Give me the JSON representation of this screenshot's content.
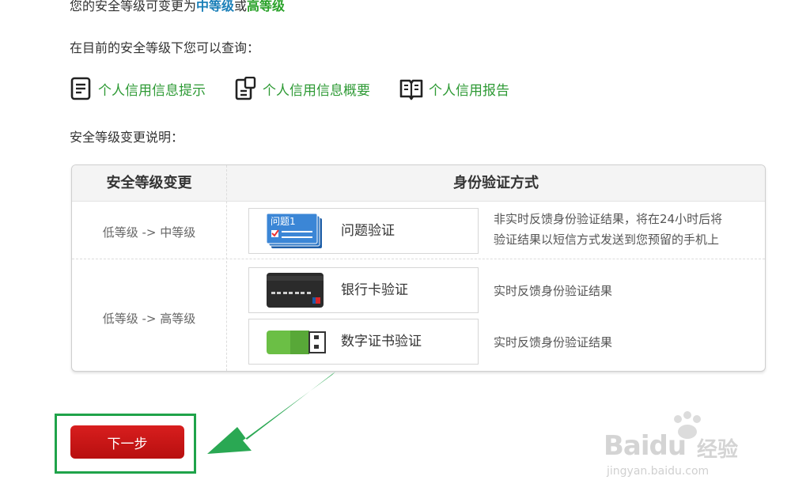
{
  "intro": {
    "prefix": "您的安全等级可变更为",
    "mid_level": "中等级",
    "connector": "或",
    "high_level": "高等级"
  },
  "query_prompt": "在目前的安全等级下您可以查询：",
  "links": [
    {
      "label": "个人信用信息提示",
      "icon": "document-list-icon"
    },
    {
      "label": "个人信用信息概要",
      "icon": "document-clip-icon"
    },
    {
      "label": "个人信用报告",
      "icon": "open-book-icon"
    }
  ],
  "change_desc": "安全等级变更说明：",
  "table": {
    "headers": {
      "level_change": "安全等级变更",
      "method": "身份验证方式"
    },
    "rows": [
      {
        "level": "低等级 -> 中等级",
        "methods": [
          {
            "name": "问题验证",
            "icon": "question-card-icon",
            "icon_text": "问题1",
            "note_line1": "非实时反馈身份验证结果，将在24小时后将",
            "note_line2": "验证结果以短信方式发送到您预留的手机上"
          }
        ]
      },
      {
        "level": "低等级 -> 高等级",
        "methods": [
          {
            "name": "银行卡验证",
            "icon": "bank-card-icon",
            "note_line1": "实时反馈身份验证结果"
          },
          {
            "name": "数字证书验证",
            "icon": "usb-key-icon",
            "note_line1": "实时反馈身份验证结果"
          }
        ]
      }
    ]
  },
  "next_button": "下一步",
  "watermark": {
    "brand": "Baidu",
    "sub": "经验",
    "url": "jingyan.baidu.com"
  },
  "colors": {
    "link_green": "#2e9a35",
    "mid_blue": "#1a7fb8",
    "button_red": "#c81414",
    "highlight_green": "#1fa34a"
  }
}
